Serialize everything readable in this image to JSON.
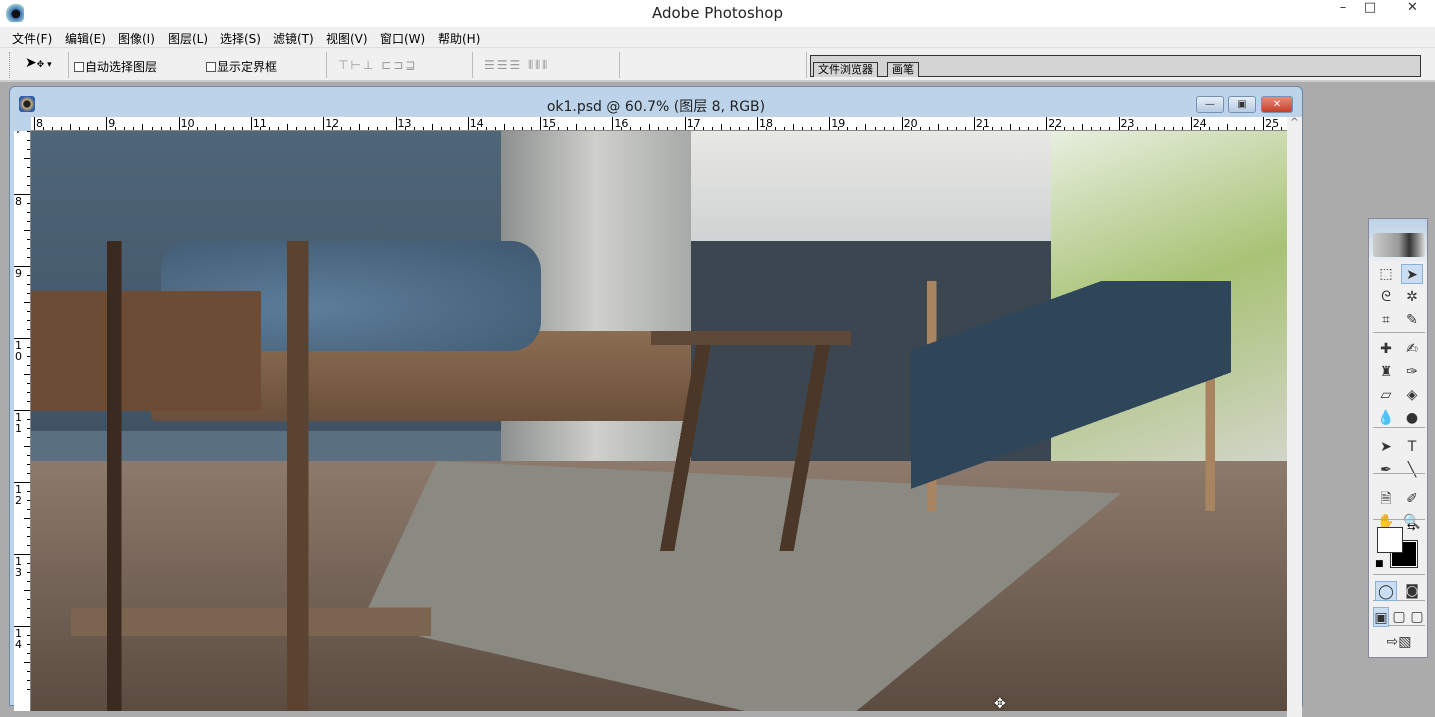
{
  "app": {
    "title": "Adobe Photoshop",
    "controls": {
      "minimize": "–",
      "maximize": "□",
      "close": "✕"
    }
  },
  "menu": [
    "文件(F)",
    "编辑(E)",
    "图像(I)",
    "图层(L)",
    "选择(S)",
    "滤镜(T)",
    "视图(V)",
    "窗口(W)",
    "帮助(H)"
  ],
  "options": {
    "auto_select_label": "自动选择图层",
    "auto_select_checked": false,
    "show_bounds_label": "显示定界框",
    "show_bounds_checked": false,
    "align_icons_1": "⊤⊢⊥ ⊏⊐⊒",
    "align_icons_2": "☰☰☰ ⫴⫴⫴"
  },
  "palette_well": {
    "tabs": [
      "文件浏览器",
      "画笔"
    ]
  },
  "document": {
    "title": "ok1.psd @ 60.7% (图层 8, RGB)",
    "controls": {
      "minimize": "—",
      "restore": "▣",
      "close": "✕"
    },
    "ruler_h": [
      "8",
      "9",
      "10",
      "11",
      "12",
      "13",
      "14",
      "15",
      "16",
      "17",
      "18",
      "19",
      "20",
      "21",
      "22",
      "23",
      "24",
      "25"
    ],
    "ruler_v": [
      "7",
      "8",
      "9",
      "10",
      "11",
      "12",
      "13",
      "14"
    ]
  },
  "toolbox": {
    "tools": [
      "rectangular-marquee",
      "move",
      "lasso",
      "magic-wand",
      "crop",
      "slice",
      "healing-brush",
      "brush",
      "clone-stamp",
      "history-brush",
      "eraser",
      "paint-bucket",
      "blur",
      "dodge",
      "path-selection",
      "type",
      "pen",
      "line",
      "notes",
      "eyedropper",
      "hand",
      "zoom"
    ],
    "glyphs": [
      "⬚",
      "➤",
      "ᘓ",
      "✲",
      "⌗",
      "✎",
      "✚",
      "✍",
      "♜",
      "✑",
      "▱",
      "◈",
      "💧",
      "●",
      "➤",
      "T",
      "✒",
      "╲",
      "🗎",
      "✐",
      "✋",
      "🔍"
    ],
    "foreground": "#ffffff",
    "background": "#000000",
    "active_tool": "move"
  }
}
